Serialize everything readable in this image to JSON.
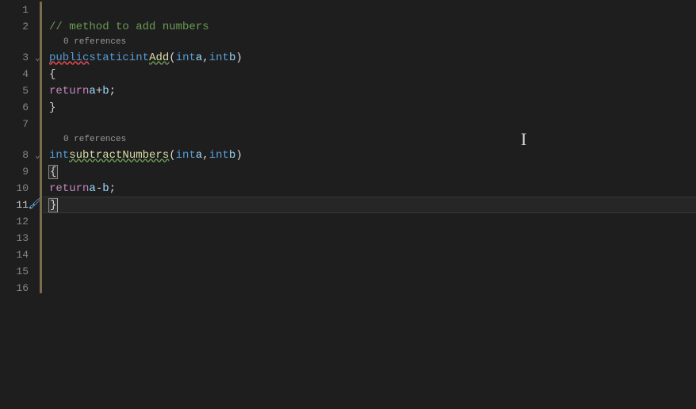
{
  "gutter": {
    "lines": [
      "1",
      "2",
      "3",
      "4",
      "5",
      "6",
      "7",
      "8",
      "9",
      "10",
      "11",
      "12",
      "13",
      "14",
      "15",
      "16"
    ]
  },
  "codelens": {
    "add": "0 references",
    "subtract": "0 references"
  },
  "code": {
    "line2_comment": "// method to add numbers",
    "line3_public": "public",
    "line3_static": "static",
    "line3_int": "int",
    "line3_fn": "Add",
    "line3_p1type": "int",
    "line3_p1": "a",
    "line3_p2type": "int",
    "line3_p2": "b",
    "line4_brace": "{",
    "line5_return": "return",
    "line5_a": "a",
    "line5_op": "+",
    "line5_b": "b",
    "line5_semi": ";",
    "line6_brace": "}",
    "line8_int": "int",
    "line8_fn": "subtractNumbers",
    "line8_p1type": "int",
    "line8_p1": "a",
    "line8_p2type": "int",
    "line8_p2": "b",
    "line9_brace": "{",
    "line10_return": "return",
    "line10_a": "a",
    "line10_op": "-",
    "line10_b": "b",
    "line10_semi": ";",
    "line11_brace": "}"
  }
}
